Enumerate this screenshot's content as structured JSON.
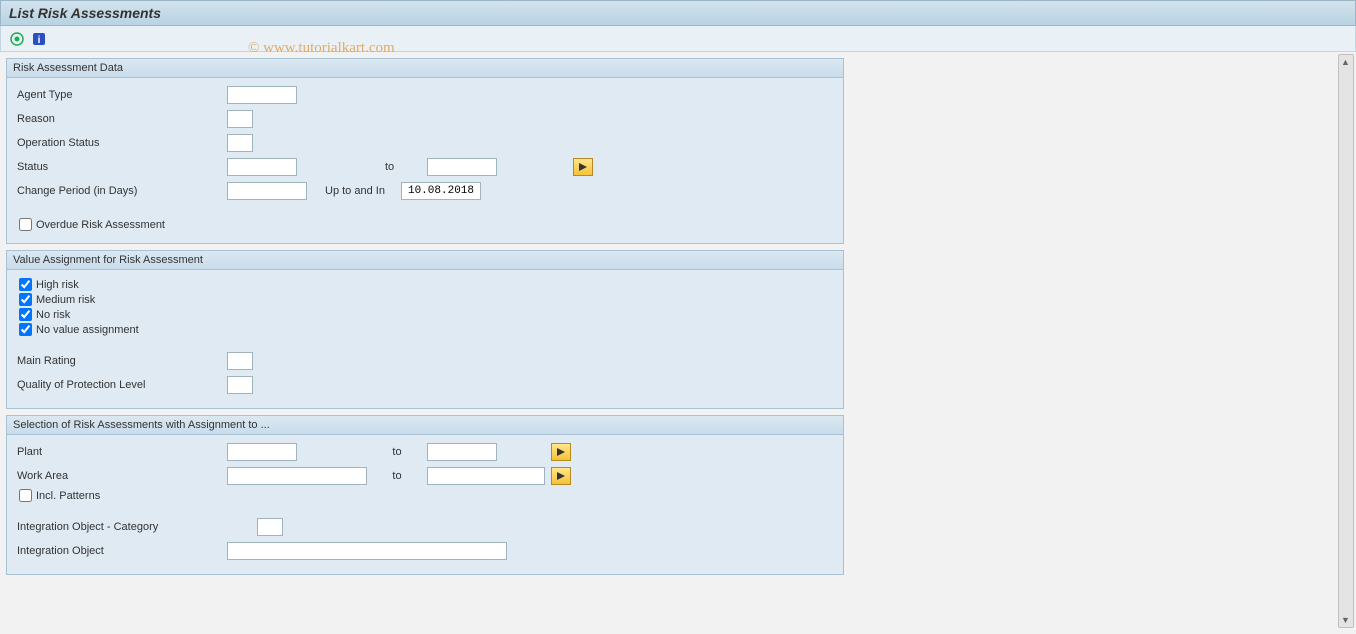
{
  "title": "List Risk Assessments",
  "watermark": "© www.tutorialkart.com",
  "panels": {
    "risk_data": {
      "title": "Risk Assessment Data",
      "agent_type": "Agent Type",
      "reason": "Reason",
      "operation_status": "Operation Status",
      "status": "Status",
      "to": "to",
      "change_period": "Change Period (in Days)",
      "up_to": "Up to and In",
      "date_value": "10.08.2018",
      "overdue": "Overdue Risk Assessment"
    },
    "value_assign": {
      "title": "Value Assignment for Risk Assessment",
      "high": "High risk",
      "medium": "Medium risk",
      "none": "No risk",
      "novalue": "No value assignment",
      "main_rating": "Main Rating",
      "protection": "Quality of Protection Level"
    },
    "selection": {
      "title": "Selection of Risk Assessments with Assignment to ...",
      "plant": "Plant",
      "work_area": "Work Area",
      "to": "to",
      "incl_patterns": "Incl. Patterns",
      "int_obj_cat": "Integration Object - Category",
      "int_obj": "Integration Object"
    }
  }
}
